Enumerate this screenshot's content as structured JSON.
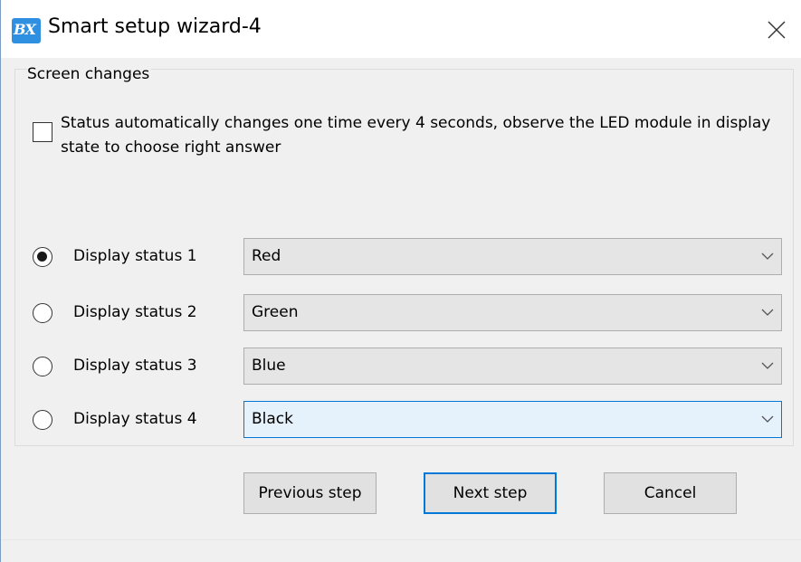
{
  "window": {
    "title": "Smart setup wizard-4",
    "icon_text": "BX",
    "icon_name": "app-logo-icon",
    "close_icon": "close-icon"
  },
  "group": {
    "title": "Screen changes"
  },
  "auto_change": {
    "checked": false,
    "label": "Status automatically changes one time every 4 seconds, observe the LED module in display state to choose right answer"
  },
  "statuses": [
    {
      "label": "Display status 1",
      "selected": true,
      "value": "Red"
    },
    {
      "label": "Display status 2",
      "selected": false,
      "value": "Green"
    },
    {
      "label": "Display status 3",
      "selected": false,
      "value": "Blue"
    },
    {
      "label": "Display status 4",
      "selected": false,
      "value": "Black"
    }
  ],
  "buttons": {
    "previous": "Previous step",
    "next": "Next step",
    "cancel": "Cancel"
  },
  "colors": {
    "accent": "#0078d7",
    "window_bg": "#f0f0f0"
  }
}
